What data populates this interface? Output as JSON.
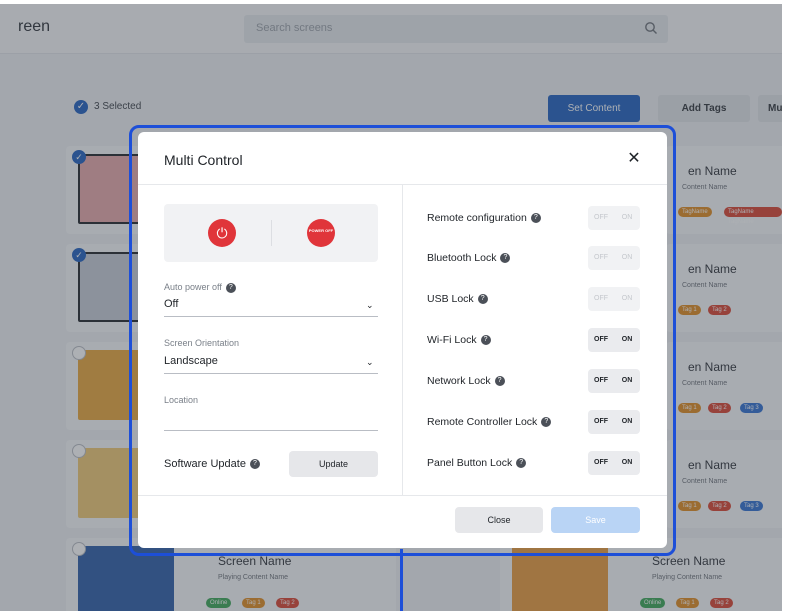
{
  "app": {
    "title": "reen"
  },
  "search": {
    "placeholder": "Search screens"
  },
  "toolbar": {
    "selected_text": "3 Selected",
    "set_content": "Set Content",
    "add_tags": "Add Tags",
    "more": "Mu"
  },
  "cards": {
    "name": "Screen Name",
    "name_partial": "en Name",
    "content": "Playing Content Name",
    "content_partial": "Content Name",
    "tags": [
      "Online",
      "Tag 1",
      "Tag 2",
      "Tag 3"
    ],
    "tags_row1": [
      "TagName",
      "TagName TagName"
    ]
  },
  "modal": {
    "title": "Multi Control",
    "power_off_label": "POWER OFF",
    "auto_power_off": {
      "label": "Auto power off",
      "value": "Off"
    },
    "screen_orientation": {
      "label": "Screen Orientation",
      "value": "Landscape"
    },
    "location": {
      "label": "Location",
      "value": ""
    },
    "software_update": {
      "label": "Software Update",
      "button": "Update"
    },
    "toggles": [
      {
        "label": "Remote configuration",
        "off": "OFF",
        "on": "ON",
        "enabled": false
      },
      {
        "label": "Bluetooth Lock",
        "off": "OFF",
        "on": "ON",
        "enabled": false
      },
      {
        "label": "USB Lock",
        "off": "OFF",
        "on": "ON",
        "enabled": false
      },
      {
        "label": "Wi-Fi Lock",
        "off": "OFF",
        "on": "ON",
        "enabled": true
      },
      {
        "label": "Network Lock",
        "off": "OFF",
        "on": "ON",
        "enabled": true
      },
      {
        "label": "Remote Controller Lock",
        "off": "OFF",
        "on": "ON",
        "enabled": true
      },
      {
        "label": "Panel Button Lock",
        "off": "OFF",
        "on": "ON",
        "enabled": true
      }
    ],
    "close_button": "Close",
    "save_button": "Save"
  },
  "colors": {
    "accent": "#1f5fbf",
    "highlight": "#1d4fd8",
    "power_red": "#e0353a",
    "tag_orange": "#e08a1e",
    "tag_red": "#d9432f",
    "tag_blue": "#2f6fd1",
    "tag_green": "#3aa655"
  }
}
